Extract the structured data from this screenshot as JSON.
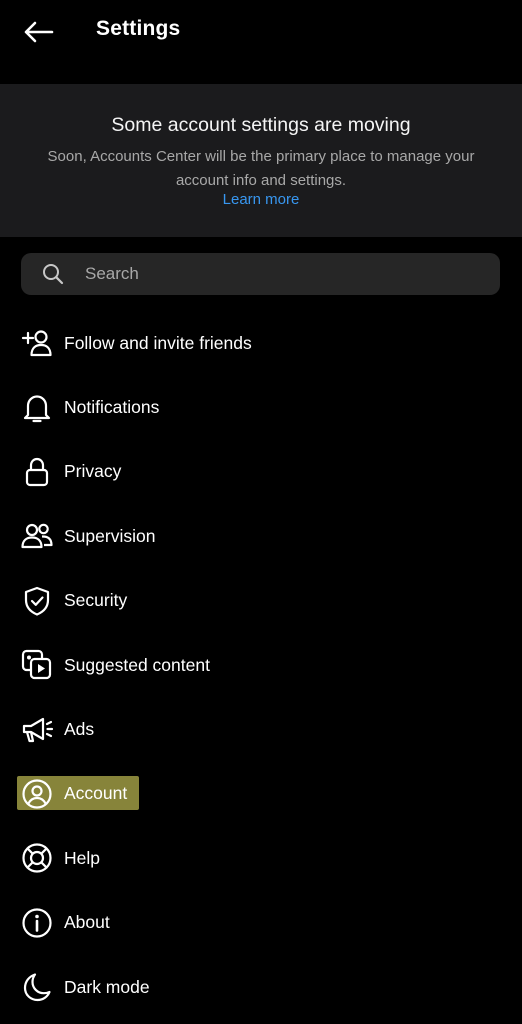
{
  "header": {
    "back_icon": "arrow-left-icon",
    "title": "Settings"
  },
  "banner": {
    "title": "Some account settings are moving",
    "body": "Soon, Accounts Center will be the primary place to manage your account info and settings.",
    "link": "Learn more",
    "link_color": "#3897f0"
  },
  "search": {
    "placeholder": "Search",
    "value": "",
    "icon": "search-icon"
  },
  "menu": {
    "items": [
      {
        "label": "Follow and invite friends",
        "icon": "add-person-icon"
      },
      {
        "label": "Notifications",
        "icon": "bell-icon"
      },
      {
        "label": "Privacy",
        "icon": "lock-icon"
      },
      {
        "label": "Supervision",
        "icon": "people-icon"
      },
      {
        "label": "Security",
        "icon": "shield-check-icon"
      },
      {
        "label": "Suggested content",
        "icon": "media-play-icon"
      },
      {
        "label": "Ads",
        "icon": "megaphone-icon"
      },
      {
        "label": "Account",
        "icon": "user-circle-icon",
        "highlighted": true
      },
      {
        "label": "Help",
        "icon": "lifebuoy-icon"
      },
      {
        "label": "About",
        "icon": "info-icon"
      },
      {
        "label": "Dark mode",
        "icon": "moon-icon"
      }
    ]
  },
  "colors": {
    "background": "#000000",
    "banner_background": "#1b1b1d",
    "search_background": "#262626",
    "highlight": "#f5f06a"
  }
}
